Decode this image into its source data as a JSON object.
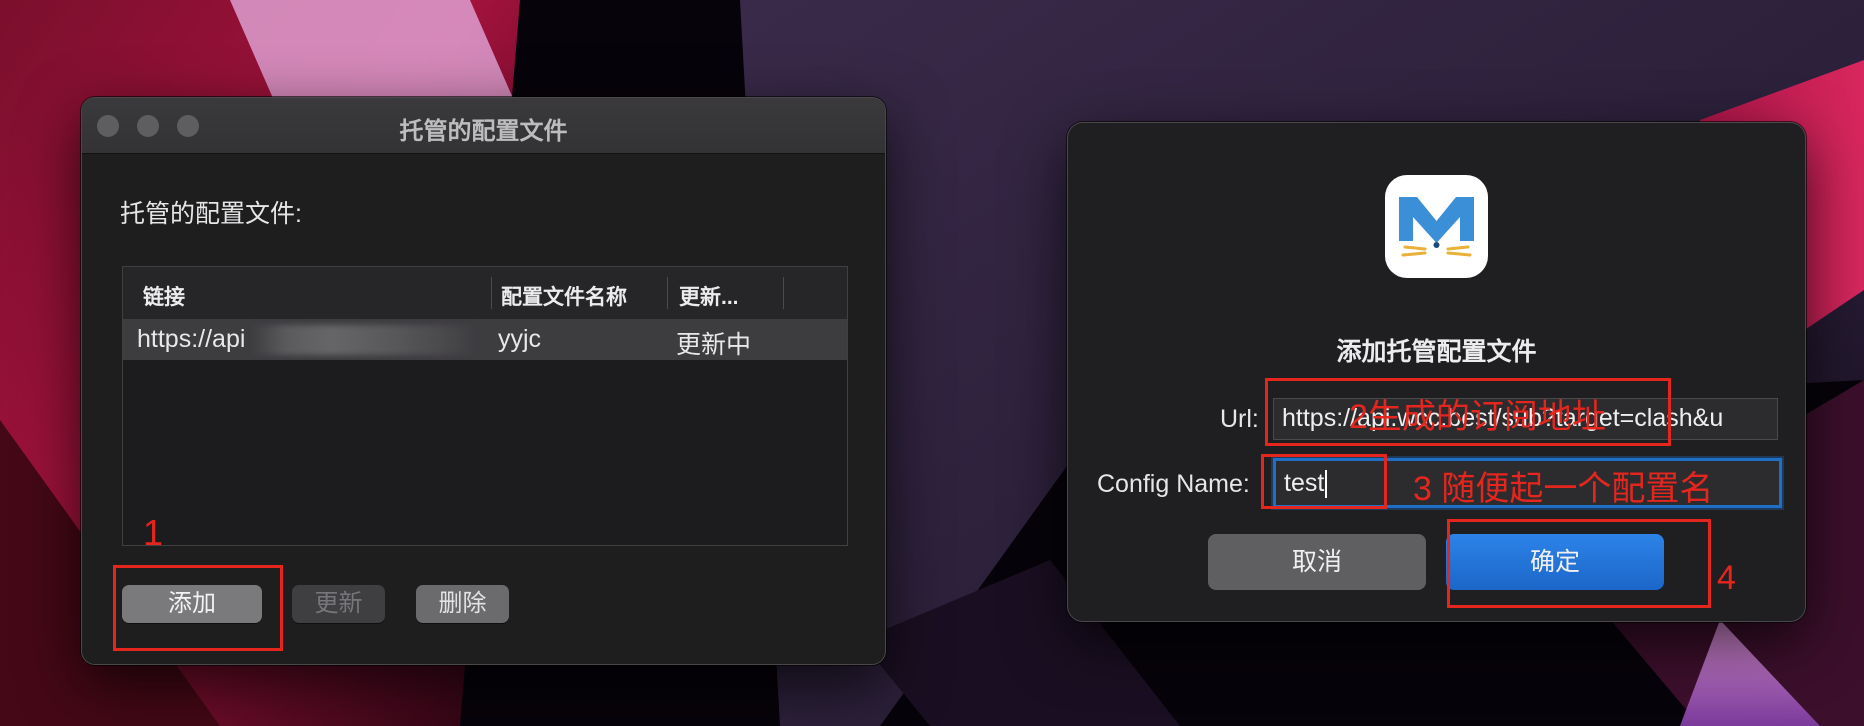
{
  "left_window": {
    "title": "托管的配置文件",
    "section_label": "托管的配置文件:",
    "columns": [
      "链接",
      "配置文件名称",
      "更新..."
    ],
    "rows": [
      {
        "link": "https://api",
        "name": "yyjc",
        "status": "更新中"
      }
    ],
    "buttons": {
      "add": "添加",
      "update": "更新",
      "delete": "删除"
    }
  },
  "dialog": {
    "title": "添加托管配置文件",
    "url_label": "Url:",
    "url_value": "https://api.wcc.best/sub?target=clash&u",
    "config_name_label": "Config Name:",
    "config_name_value": "test",
    "cancel_label": "取消",
    "ok_label": "确定"
  },
  "annotations": {
    "step1": "1",
    "step2": "2生成的订阅地址",
    "step3": "3 随便起一个配置名",
    "step4": "4"
  },
  "colors": {
    "annotation_red": "#e5261f",
    "accent_blue": "#1f6fc6"
  }
}
